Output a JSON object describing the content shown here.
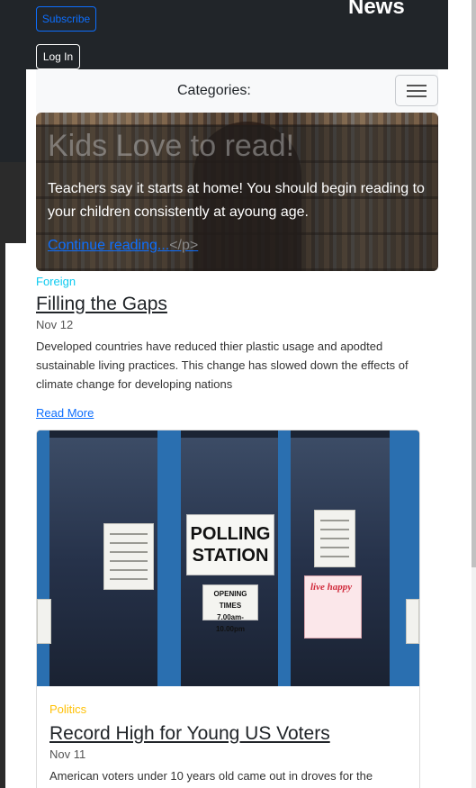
{
  "header": {
    "subscribe_label": "Subscribe",
    "login_label": "Log In",
    "brand": "News"
  },
  "category_bar": {
    "label": "Categories:",
    "toggler_icon": "hamburger-menu-icon"
  },
  "hero": {
    "title": "Kids Love to read!",
    "text": "Teachers say it starts at home! You should begin reading to your children consistently at ayoung age.",
    "link": "Continue reading...",
    "link_tail": "</p>"
  },
  "articles": [
    {
      "category": "Foreign",
      "title": "Filling the Gaps",
      "date": "Nov 12",
      "body": "Developed countries have reduced thier plastic usage and apodted sustainable living practices. This change has slowed down the effects of climate change for developing nations",
      "read_more": "Read More"
    }
  ],
  "card": {
    "image": {
      "sign_line1": "POLLING",
      "sign_line2": "STATION",
      "hours_title": "OPENING TIMES",
      "hours_value": "7.00am-10.00pm",
      "poster_text": "live happy"
    },
    "category": "Politics",
    "title": "Record High for Young US Voters",
    "date": "Nov 11",
    "body": "American voters under 10 years old came out in droves for the"
  },
  "colors": {
    "header_bg": "#212529",
    "primary": "#0d6efd",
    "foreign_tag": "#0dcaf0",
    "politics_tag": "#ffc107"
  }
}
